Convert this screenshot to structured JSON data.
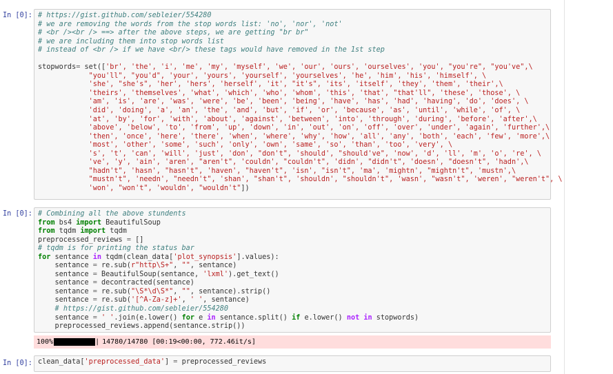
{
  "cells": [
    {
      "prompt": "In [0]:",
      "comments": [
        "# https://gist.github.com/sebleier/554280",
        "# we are removing the words from the stop words list: 'no', 'nor', 'not'",
        "# <br /><br /> ==> after the above steps, we are getting \"br br\"",
        "# we are including them into stop words list",
        "# instead of <br /> if we have <br/> these tags would have removed in the 1st step"
      ],
      "stopwords_lines": [
        "'br', 'the', 'i', 'me', 'my', 'myself', 'we', 'our', 'ours', 'ourselves', 'you', \"you're\", \"you've\",\\",
        "            \"you'll\", \"you'd\", 'your', 'yours', 'yourself', 'yourselves', 'he', 'him', 'his', 'himself', \\",
        "            'she', \"she's\", 'her', 'hers', 'herself', 'it', \"it's\", 'its', 'itself', 'they', 'them', 'their',\\",
        "            'theirs', 'themselves', 'what', 'which', 'who', 'whom', 'this', 'that', \"that'll\", 'these', 'those', \\",
        "            'am', 'is', 'are', 'was', 'were', 'be', 'been', 'being', 'have', 'has', 'had', 'having', 'do', 'does', \\",
        "            'did', 'doing', 'a', 'an', 'the', 'and', 'but', 'if', 'or', 'because', 'as', 'until', 'while', 'of', \\",
        "            'at', 'by', 'for', 'with', 'about', 'against', 'between', 'into', 'through', 'during', 'before', 'after',\\",
        "            'above', 'below', 'to', 'from', 'up', 'down', 'in', 'out', 'on', 'off', 'over', 'under', 'again', 'further',\\",
        "            'then', 'once', 'here', 'there', 'when', 'where', 'why', 'how', 'all', 'any', 'both', 'each', 'few', 'more',\\",
        "            'most', 'other', 'some', 'such', 'only', 'own', 'same', 'so', 'than', 'too', 'very', \\",
        "            's', 't', 'can', 'will', 'just', 'don', \"don't\", 'should', \"should've\", 'now', 'd', 'll', 'm', 'o', 're', \\",
        "            've', 'y', 'ain', 'aren', \"aren't\", 'couldn', \"couldn't\", 'didn', \"didn't\", 'doesn', \"doesn't\", 'hadn',\\",
        "            \"hadn't\", 'hasn', \"hasn't\", 'haven', \"haven't\", 'isn', \"isn't\", 'ma', 'mightn', \"mightn't\", 'mustn',\\",
        "            \"mustn't\", 'needn', \"needn't\", 'shan', \"shan't\", 'shouldn', \"shouldn't\", 'wasn', \"wasn't\", 'weren', \"weren't\", \\",
        "            'won', \"won't\", 'wouldn', \"wouldn't\""
      ]
    },
    {
      "prompt": "In [0]:",
      "progress": {
        "percent_label": "100%",
        "fraction": 1.0,
        "stats": "14780/14780 [00:19<00:00, 772.46it/s]"
      }
    },
    {
      "prompt": "In [0]:"
    }
  ]
}
